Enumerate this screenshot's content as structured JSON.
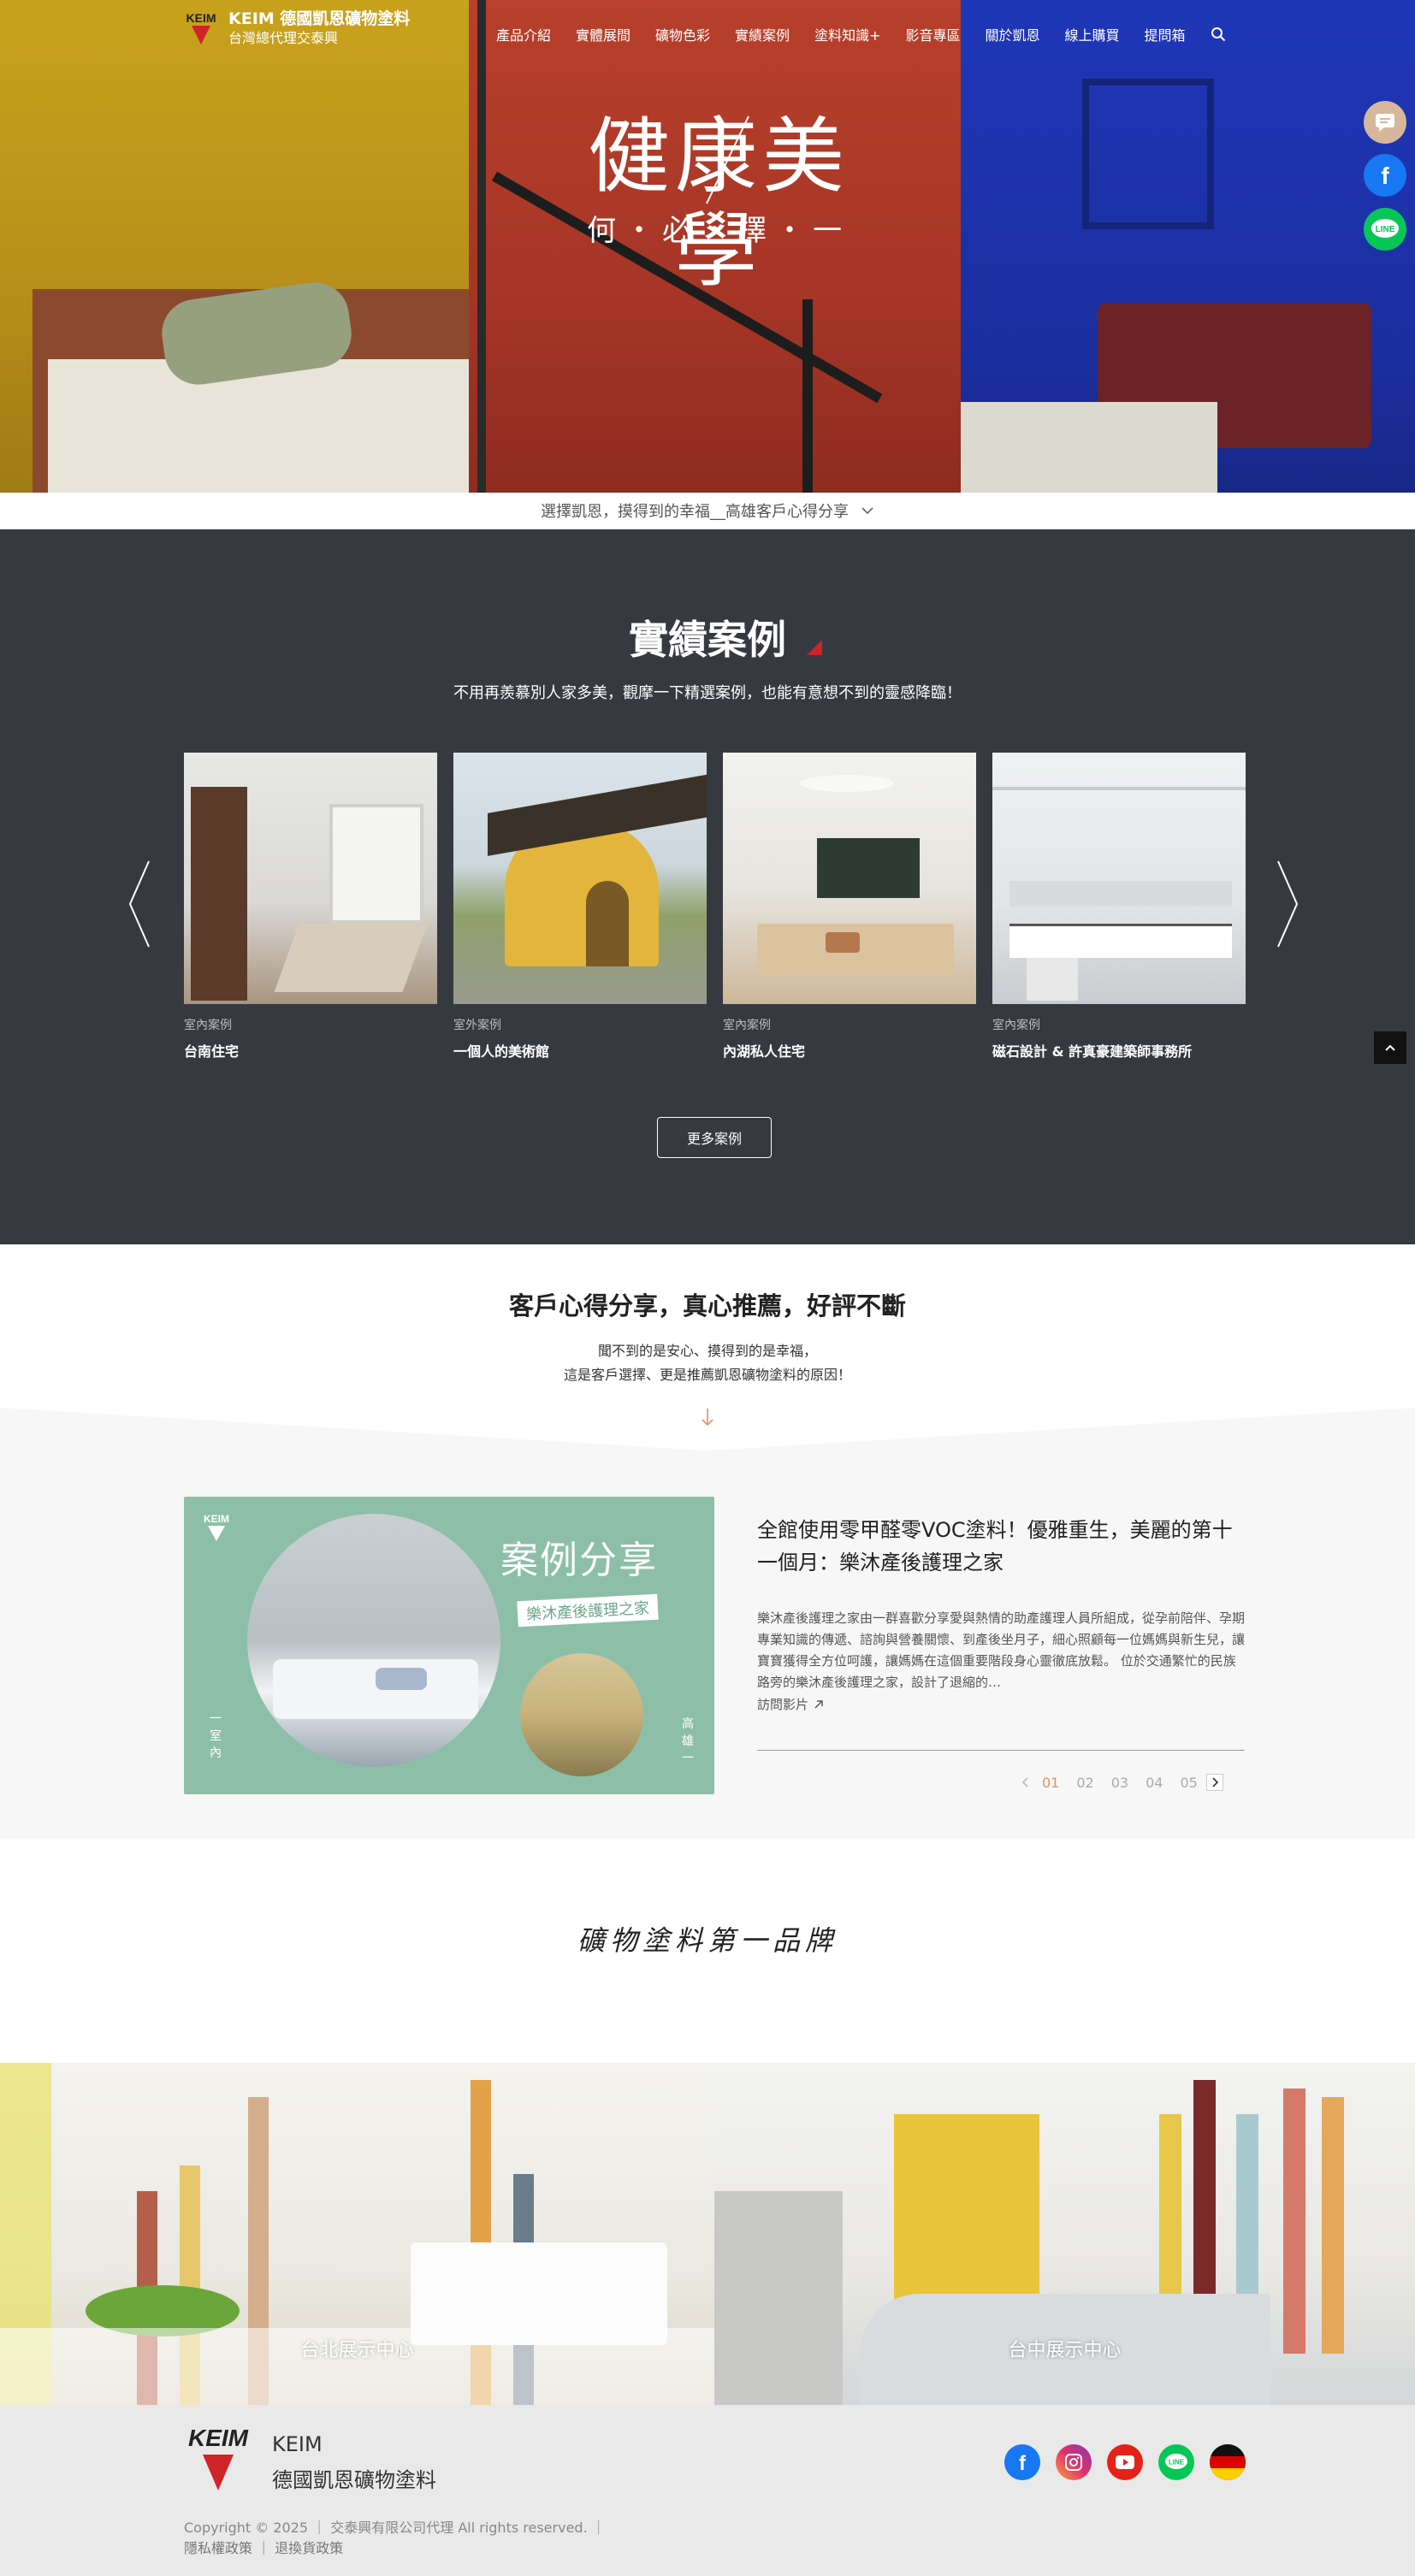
{
  "header": {
    "brand_line1": "KEIM 德國凱恩礦物塗料",
    "brand_line2": "台灣總代理交泰興",
    "logo_text": "KEIM",
    "nav": [
      "產品介紹",
      "實體展間",
      "礦物色彩",
      "實績案例",
      "塗料知識+",
      "影音專區",
      "關於凱恩",
      "線上購買",
      "提問箱"
    ]
  },
  "hero": {
    "title": "健康美學",
    "subtitle": "何・必・擇・一"
  },
  "announcement": "選擇凱恩，摸得到的幸福__高雄客戶心得分享",
  "cases": {
    "title": "實績案例",
    "subtitle": "不用再羨慕別人家多美，觀摩一下精選案例，也能有意想不到的靈感降臨！",
    "items": [
      {
        "category": "室內案例",
        "name": "台南住宅"
      },
      {
        "category": "室外案例",
        "name": "一個人的美術館"
      },
      {
        "category": "室內案例",
        "name": "內湖私人住宅"
      },
      {
        "category": "室內案例",
        "name": "磁石設計 & 許真豪建築師事務所"
      }
    ],
    "more_label": "更多案例"
  },
  "share": {
    "title": "客戶心得分享，真心推薦，好評不斷",
    "desc_line1": "聞不到的是安心、摸得到的是幸福，",
    "desc_line2": "這是客戶選擇、更是推薦凱恩礦物塗料的原因！",
    "banner_title": "案例分享",
    "banner_tag": "樂沐產後護理之家",
    "banner_side_left": "一室內",
    "banner_side_right": "高雄一",
    "article_title": "全館使用零甲醛零VOC塗料！優雅重生，美麗的第十一個月：樂沐產後護理之家",
    "article_body": "樂沐產後護理之家由一群喜歡分享愛與熱情的助產護理人員所組成，從孕前陪伴、孕期專業知識的傳遞、諮詢與營養關懷、到產後坐月子，細心照顧每一位媽媽與新生兒，讓寶寶獲得全方位呵護，讓媽媽在這個重要階段身心靈徹底放鬆。 位於交通繁忙的民族路旁的樂沐產後護理之家，設計了退縮的…",
    "article_link": "訪問影片",
    "pages": [
      "01",
      "02",
      "03",
      "04",
      "05"
    ],
    "active_page": "01"
  },
  "brandline": "礦物塗料第一品牌",
  "showrooms": [
    {
      "name": "台北展示中心"
    },
    {
      "name": "台中展示中心"
    }
  ],
  "footer": {
    "logo_text": "KEIM",
    "brand_en": "KEIM",
    "brand_zh": "德國凱恩礦物塗料",
    "copyright": "Copyright © 2025 ｜ 交泰興有限公司代理 All rights reserved. ｜",
    "links": "隱私權政策 ｜ 退換貨政策"
  },
  "colors": {
    "dark_section": "#363a40",
    "accent_red": "#d0232a",
    "banner_green": "#8dbfa8",
    "facebook": "#1877f2",
    "line": "#06c755"
  }
}
